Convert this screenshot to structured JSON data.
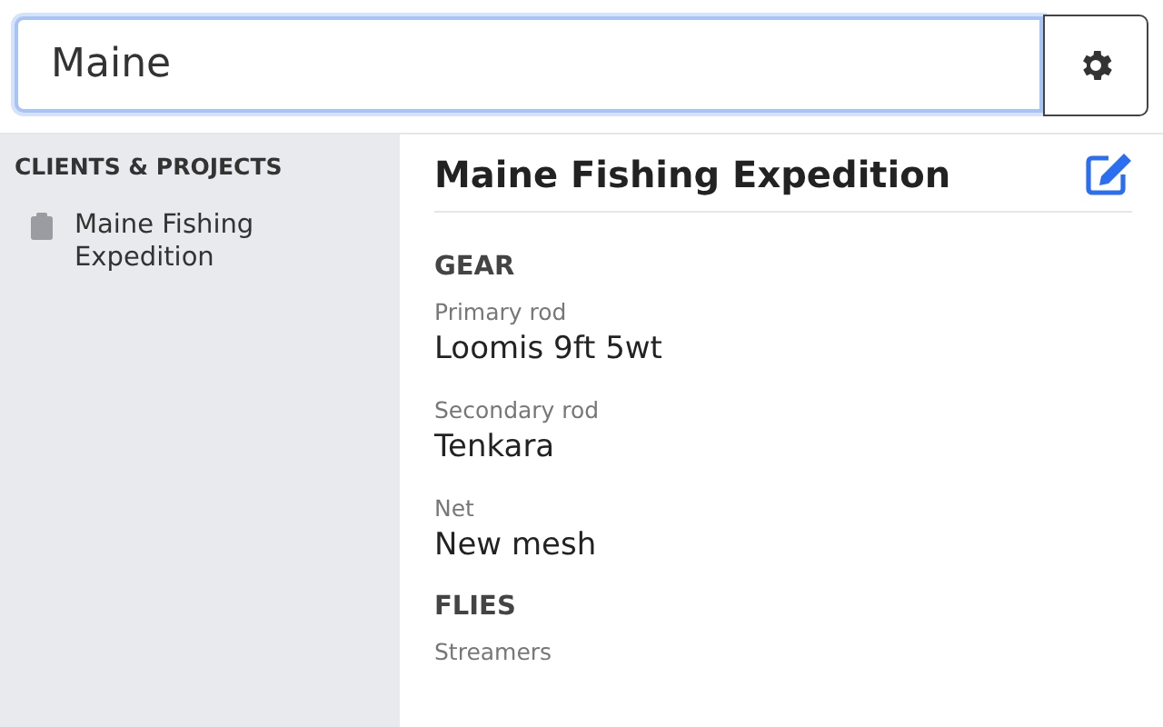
{
  "search": {
    "value": "Maine"
  },
  "sidebar": {
    "heading": "CLIENTS & PROJECTS",
    "items": [
      {
        "label": "Maine Fishing Expedition"
      }
    ]
  },
  "detail": {
    "title": "Maine Fishing Expedition",
    "sections": [
      {
        "heading": "GEAR",
        "fields": [
          {
            "label": "Primary rod",
            "value": "Loomis 9ft 5wt"
          },
          {
            "label": "Secondary rod",
            "value": "Tenkara"
          },
          {
            "label": "Net",
            "value": "New mesh"
          }
        ]
      },
      {
        "heading": "FLIES",
        "fields": [
          {
            "label": "Streamers"
          }
        ]
      }
    ]
  }
}
